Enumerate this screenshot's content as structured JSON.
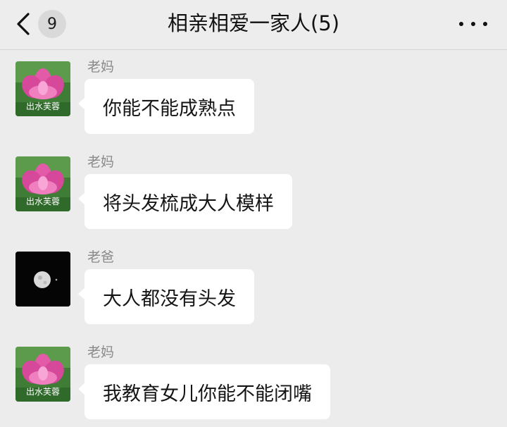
{
  "header": {
    "title": "相亲相爱一家人(5)",
    "unread_count": "9"
  },
  "messages": [
    {
      "sender": "老妈",
      "avatar": "lotus-avatar",
      "avatar_text": "出水芙蓉",
      "text": "你能不能成熟点"
    },
    {
      "sender": "老妈",
      "avatar": "lotus-avatar",
      "avatar_text": "出水芙蓉",
      "text": "将头发梳成大人模样"
    },
    {
      "sender": "老爸",
      "avatar": "moon-avatar",
      "text": "大人都没有头发"
    },
    {
      "sender": "老妈",
      "avatar": "lotus-avatar",
      "avatar_text": "出水芙蓉",
      "text": "我教育女儿你能不能闭嘴"
    }
  ],
  "colors": {
    "background": "#ececec",
    "bubble": "#ffffff",
    "sender_name": "#8a8a8a"
  }
}
